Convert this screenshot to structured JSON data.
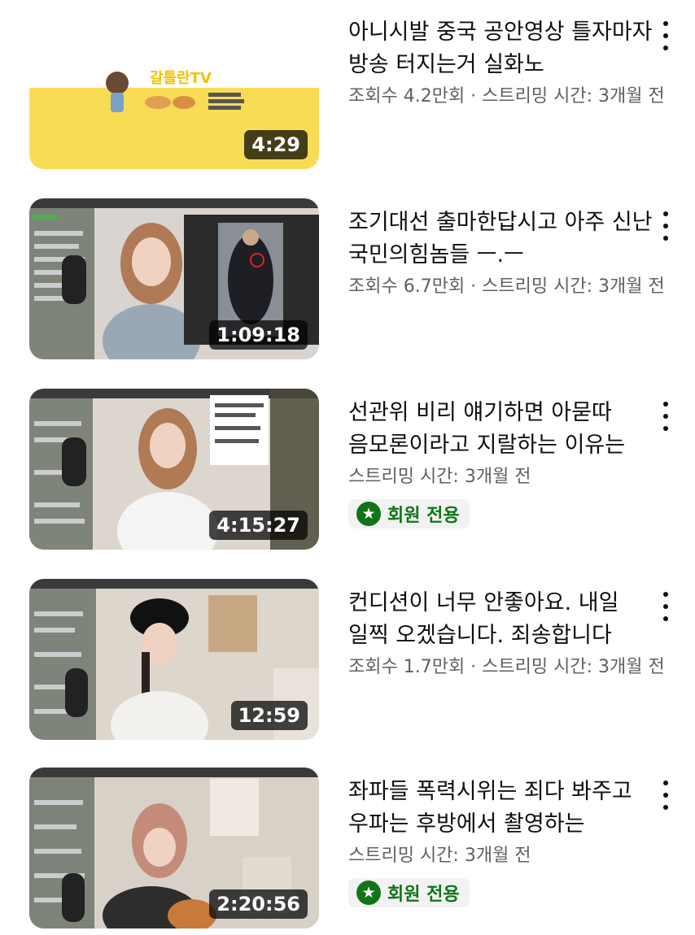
{
  "videos": [
    {
      "title": "아니시발 중국 공안영상 틀자마자 방송 터지는거 실화노",
      "meta": "조회수 4.2만회 · 스트리밍 시간: 3개월 전",
      "duration": "4:29",
      "thumb_logo": "갈틀란TV"
    },
    {
      "title": "조기대선 출마한답시고 아주 신난 국민의힘놈들 ㅡ.ㅡ",
      "meta": "조회수 6.7만회 · 스트리밍 시간: 3개월 전",
      "duration": "1:09:18"
    },
    {
      "title": "선관위 비리 얘기하면 아묻따 음모론이라고 지랄하는 이유는",
      "meta": "스트리밍 시간: 3개월 전",
      "duration": "4:15:27",
      "badge": "회원 전용"
    },
    {
      "title": "컨디션이 너무 안좋아요. 내일 일찍 오겠습니다. 죄송합니다",
      "meta": "조회수 1.7만회 · 스트리밍 시간: 3개월 전",
      "duration": "12:59"
    },
    {
      "title": "좌파들 폭력시위는 죄다 봐주고 우파는 후방에서 촬영하는",
      "meta": "스트리밍 시간: 3개월 전",
      "duration": "2:20:56",
      "badge": "회원 전용"
    }
  ],
  "colors": {
    "badge_green": "#107516",
    "meta_gray": "#606060",
    "yellow_thumb": "#f8dc55"
  },
  "icons": {
    "more": "more-vert-icon",
    "badge": "star-icon"
  }
}
